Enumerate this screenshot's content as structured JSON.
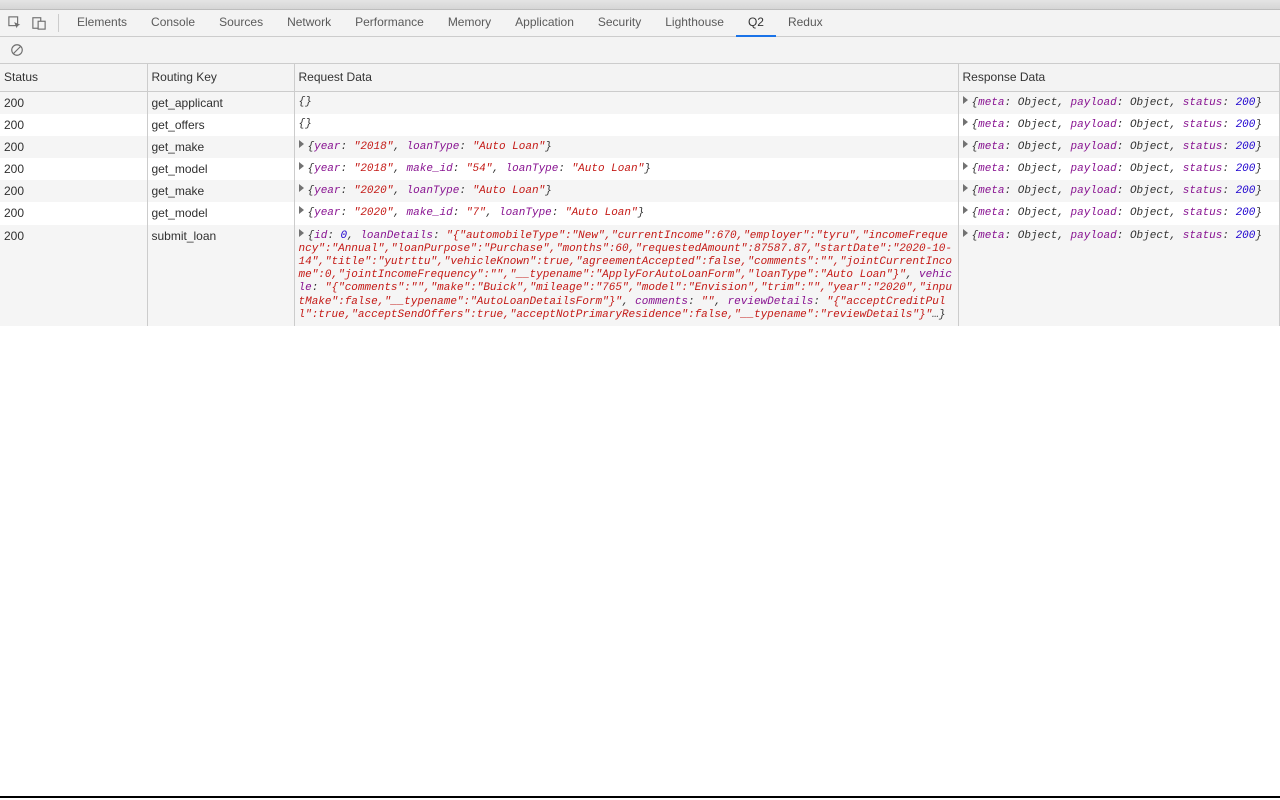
{
  "tabs": [
    "Elements",
    "Console",
    "Sources",
    "Network",
    "Performance",
    "Memory",
    "Application",
    "Security",
    "Lighthouse",
    "Q2",
    "Redux"
  ],
  "active_tab": "Q2",
  "columns": {
    "status": "Status",
    "routing": "Routing Key",
    "request": "Request Data",
    "response": "Response Data"
  },
  "response_template": {
    "meta": "meta",
    "obj": "Object",
    "payload": "payload",
    "status_key": "status",
    "status_val": "200"
  },
  "rows": [
    {
      "status": "200",
      "routing": "get_applicant",
      "request": [
        {
          "type": "empty"
        }
      ]
    },
    {
      "status": "200",
      "routing": "get_offers",
      "request": [
        {
          "type": "empty"
        }
      ]
    },
    {
      "status": "200",
      "routing": "get_make",
      "request": [
        {
          "type": "k",
          "v": "year"
        },
        {
          "type": "p",
          "v": ": "
        },
        {
          "type": "s",
          "v": "\"2018\""
        },
        {
          "type": "p",
          "v": ", "
        },
        {
          "type": "k",
          "v": "loanType"
        },
        {
          "type": "p",
          "v": ": "
        },
        {
          "type": "s",
          "v": "\"Auto Loan\""
        }
      ]
    },
    {
      "status": "200",
      "routing": "get_model",
      "request": [
        {
          "type": "k",
          "v": "year"
        },
        {
          "type": "p",
          "v": ": "
        },
        {
          "type": "s",
          "v": "\"2018\""
        },
        {
          "type": "p",
          "v": ", "
        },
        {
          "type": "k",
          "v": "make_id"
        },
        {
          "type": "p",
          "v": ": "
        },
        {
          "type": "s",
          "v": "\"54\""
        },
        {
          "type": "p",
          "v": ", "
        },
        {
          "type": "k",
          "v": "loanType"
        },
        {
          "type": "p",
          "v": ": "
        },
        {
          "type": "s",
          "v": "\"Auto Loan\""
        }
      ]
    },
    {
      "status": "200",
      "routing": "get_make",
      "request": [
        {
          "type": "k",
          "v": "year"
        },
        {
          "type": "p",
          "v": ": "
        },
        {
          "type": "s",
          "v": "\"2020\""
        },
        {
          "type": "p",
          "v": ", "
        },
        {
          "type": "k",
          "v": "loanType"
        },
        {
          "type": "p",
          "v": ": "
        },
        {
          "type": "s",
          "v": "\"Auto Loan\""
        }
      ]
    },
    {
      "status": "200",
      "routing": "get_model",
      "request": [
        {
          "type": "k",
          "v": "year"
        },
        {
          "type": "p",
          "v": ": "
        },
        {
          "type": "s",
          "v": "\"2020\""
        },
        {
          "type": "p",
          "v": ", "
        },
        {
          "type": "k",
          "v": "make_id"
        },
        {
          "type": "p",
          "v": ": "
        },
        {
          "type": "s",
          "v": "\"7\""
        },
        {
          "type": "p",
          "v": ", "
        },
        {
          "type": "k",
          "v": "loanType"
        },
        {
          "type": "p",
          "v": ": "
        },
        {
          "type": "s",
          "v": "\"Auto Loan\""
        }
      ]
    },
    {
      "status": "200",
      "routing": "submit_loan",
      "request": [
        {
          "type": "k",
          "v": "id"
        },
        {
          "type": "p",
          "v": ": "
        },
        {
          "type": "n",
          "v": "0"
        },
        {
          "type": "p",
          "v": ", "
        },
        {
          "type": "k",
          "v": "loanDetails"
        },
        {
          "type": "p",
          "v": ": "
        },
        {
          "type": "s",
          "v": "\"{\"automobileType\":\"New\",\"currentIncome\":670,\"employer\":\"tyru\",\"incomeFrequency\":\"Annual\",\"loanPurpose\":\"Purchase\",\"months\":60,\"requestedAmount\":87587.87,\"startDate\":\"2020-10-14\",\"title\":\"yutrttu\",\"vehicleKnown\":true,\"agreementAccepted\":false,\"comments\":\"\",\"jointCurrentIncome\":0,\"jointIncomeFrequency\":\"\",\"__typename\":\"ApplyForAutoLoanForm\",\"loanType\":\"Auto Loan\"}\""
        },
        {
          "type": "p",
          "v": ", "
        },
        {
          "type": "k",
          "v": "vehicle"
        },
        {
          "type": "p",
          "v": ": "
        },
        {
          "type": "s",
          "v": "\"{\"comments\":\"\",\"make\":\"Buick\",\"mileage\":\"765\",\"model\":\"Envision\",\"trim\":\"\",\"year\":\"2020\",\"inputMake\":false,\"__typename\":\"AutoLoanDetailsForm\"}\""
        },
        {
          "type": "p",
          "v": ", "
        },
        {
          "type": "k",
          "v": "comments"
        },
        {
          "type": "p",
          "v": ": "
        },
        {
          "type": "s",
          "v": "\"\""
        },
        {
          "type": "p",
          "v": ", "
        },
        {
          "type": "k",
          "v": "reviewDetails"
        },
        {
          "type": "p",
          "v": ": "
        },
        {
          "type": "s",
          "v": "\"{\"acceptCreditPull\":true,\"acceptSendOffers\":true,\"acceptNotPrimaryResidence\":false,\"__typename\":\"reviewDetails\"}\""
        },
        {
          "type": "p",
          "v": "…"
        }
      ]
    }
  ]
}
